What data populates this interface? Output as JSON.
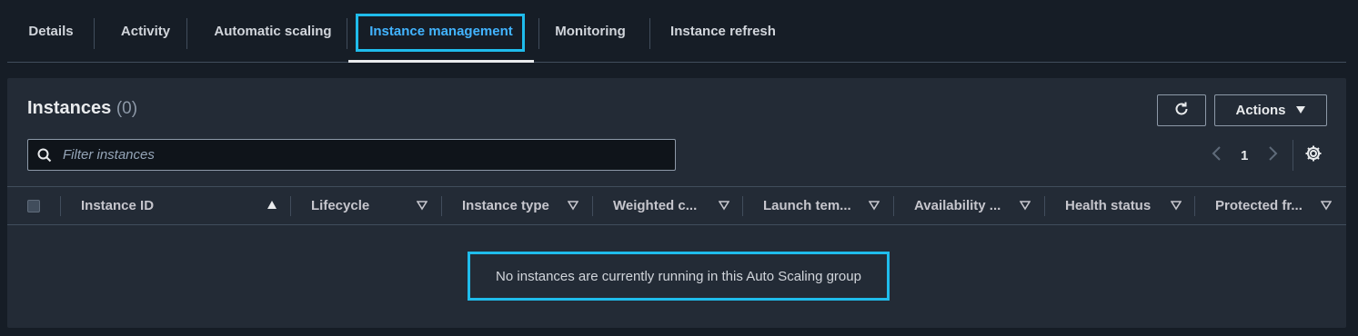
{
  "tabs": [
    {
      "label": "Details"
    },
    {
      "label": "Activity"
    },
    {
      "label": "Automatic scaling"
    },
    {
      "label": "Instance management",
      "active": true
    },
    {
      "label": "Monitoring"
    },
    {
      "label": "Instance refresh"
    }
  ],
  "header": {
    "title": "Instances",
    "count": "(0)",
    "actions_label": "Actions"
  },
  "filter": {
    "placeholder": "Filter instances"
  },
  "pagination": {
    "current_page": "1"
  },
  "table": {
    "columns": [
      {
        "label": "Instance ID",
        "sort": "ascending"
      },
      {
        "label": "Lifecycle"
      },
      {
        "label": "Instance type"
      },
      {
        "label": "Weighted c..."
      },
      {
        "label": "Launch tem..."
      },
      {
        "label": "Availability ..."
      },
      {
        "label": "Health status"
      },
      {
        "label": "Protected fr..."
      }
    ],
    "empty_message": "No instances are currently running in this Auto Scaling group"
  },
  "colors": {
    "accent": "#42b4ff",
    "highlight": "#1fbcec",
    "background": "#161d26",
    "panel": "#232b36"
  }
}
